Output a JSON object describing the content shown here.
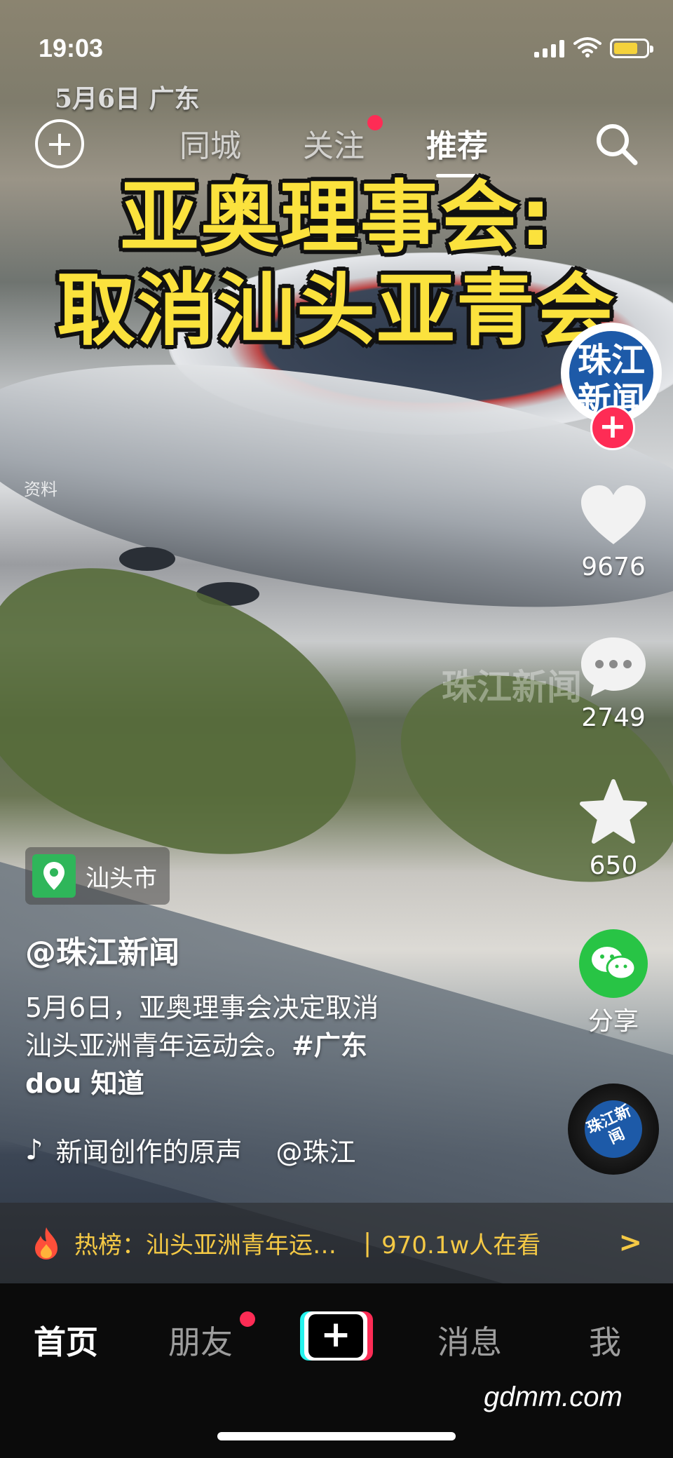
{
  "status_bar": {
    "time": "19:03"
  },
  "video_meta": {
    "date_location": "5月6日 广东",
    "source_tag": "资料",
    "watermark": "珠江新闻"
  },
  "top_nav": {
    "tabs": [
      {
        "label": "同城"
      },
      {
        "label": "关注"
      },
      {
        "label": "推荐"
      }
    ],
    "active_tab": "推荐"
  },
  "headline": {
    "line1": "亚奥理事会:",
    "line2": "取消汕头亚青会"
  },
  "creator": {
    "avatar_text": "珠江新闻",
    "follow_symbol": "+"
  },
  "actions": {
    "likes": "9676",
    "comments": "2749",
    "favorites": "650",
    "share_label": "分享"
  },
  "post": {
    "location": "汕头市",
    "author": "@珠江新闻",
    "description_line1": "5月6日，亚奥理事会决定取消",
    "description_line2_text": "汕头亚洲青年运动会。",
    "description_tag": "#广东",
    "description_line3": "dou 知道",
    "music_title": "新闻创作的原声",
    "music_author": "@珠江"
  },
  "music_disc": {
    "text": "珠江新闻"
  },
  "hot_bar": {
    "text": "热榜：汕头亚洲青年运…",
    "viewers": "970.1w人在看"
  },
  "bottom_nav": {
    "home": "首页",
    "friends": "朋友",
    "create_symbol": "+",
    "messages": "消息",
    "me": "我"
  },
  "site_watermark": "gdmm.com",
  "colors": {
    "accent_red": "#fe2c55",
    "headline_yellow": "#fbe23d",
    "hot_yellow": "#f5c945",
    "share_green": "#28c445"
  }
}
